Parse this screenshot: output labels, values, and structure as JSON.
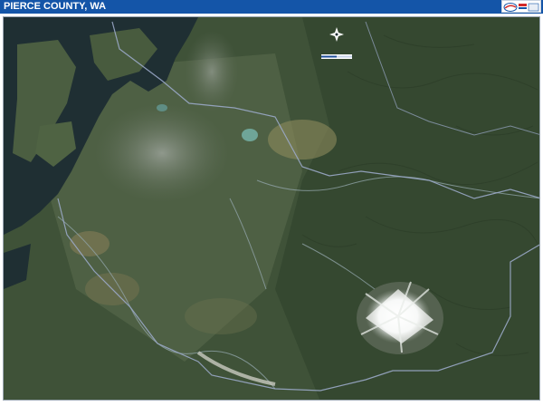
{
  "header": {
    "title": "PIERCE COUNTY, WA",
    "bar_color": "#1455a8"
  },
  "map": {
    "type": "satellite",
    "icons": [
      "compass-rose-icon",
      "scale-bar-icon",
      "publisher-logo-icon"
    ]
  }
}
